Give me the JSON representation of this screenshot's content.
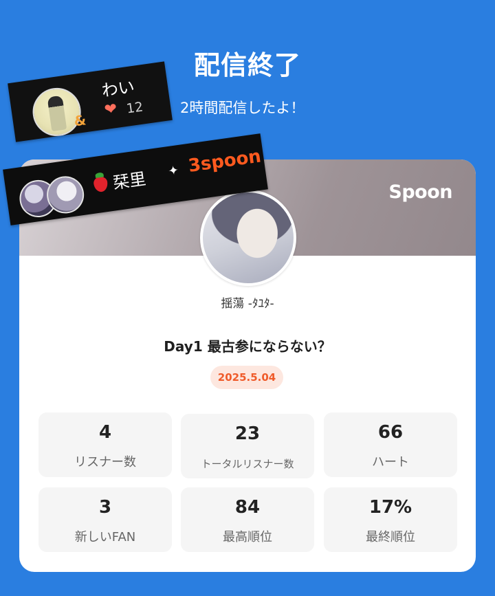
{
  "header": {
    "title": "配信終了",
    "subtitle": "2時間配信したよ！"
  },
  "sticker_user": {
    "name": "わい",
    "hearts": "12",
    "heart_icon": "heart-icon",
    "heart_color": "#ff6f5c"
  },
  "sticker_gift": {
    "gift_user": "栞里",
    "amount": "3spoon",
    "amount_color": "#ff5a1f"
  },
  "card": {
    "brand": "Spoon",
    "host_name": "揺蕩 -ﾀﾕﾀ-",
    "broadcast_title": "Day1 最古参にならない？",
    "date": "2025.5.04",
    "stats": [
      {
        "value": "4",
        "label": "リスナー数"
      },
      {
        "value": "23",
        "label": "トータルリスナー数"
      },
      {
        "value": "66",
        "label": "ハート"
      },
      {
        "value": "3",
        "label": "新しいFAN"
      },
      {
        "value": "84",
        "label": "最高順位"
      },
      {
        "value": "17%",
        "label": "最終順位"
      }
    ]
  },
  "colors": {
    "background": "#2a7ee0",
    "accent": "#ef5b2a",
    "date_badge_bg": "#fde7df"
  }
}
